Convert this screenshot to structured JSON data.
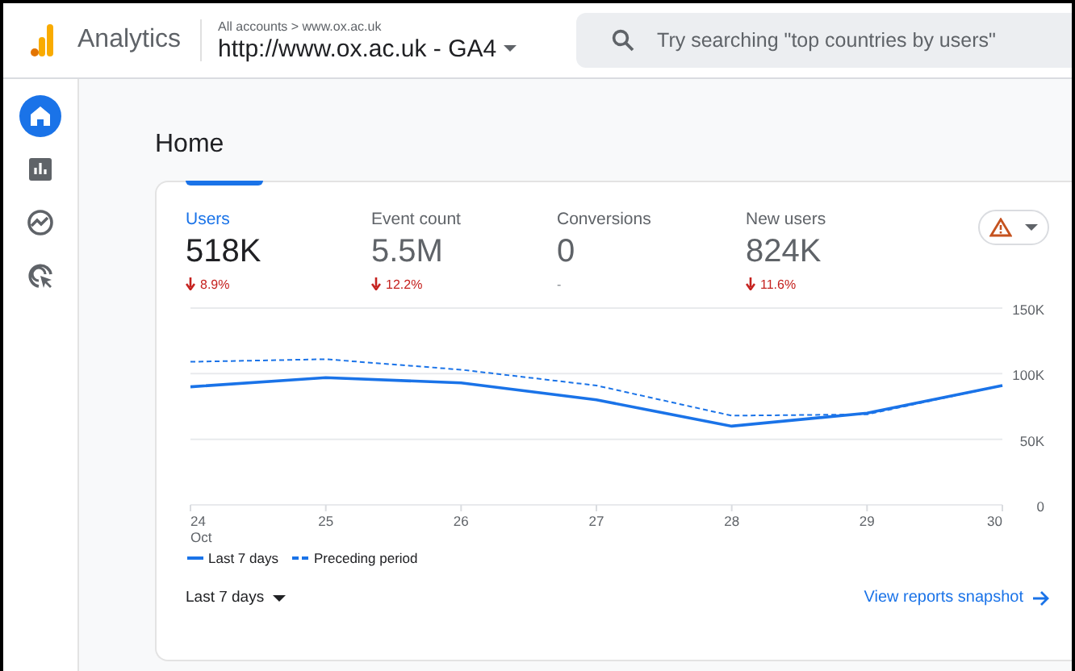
{
  "header": {
    "product": "Analytics",
    "breadcrumb": "All accounts > www.ox.ac.uk",
    "property": "http://www.ox.ac.uk - GA4",
    "search": {
      "placeholder": "Try searching \"top countries by users\""
    }
  },
  "sidebar": {
    "items": [
      {
        "kind": "home",
        "selected": true
      },
      {
        "kind": "reports",
        "selected": false
      },
      {
        "kind": "explore",
        "selected": false
      },
      {
        "kind": "advertising",
        "selected": false
      }
    ]
  },
  "page": {
    "title": "Home"
  },
  "metrics": [
    {
      "label": "Users",
      "value": "518K",
      "change": "8.9%",
      "kind": "down",
      "selected": true
    },
    {
      "label": "Event count",
      "value": "5.5M",
      "change": "12.2%",
      "kind": "down",
      "selected": false
    },
    {
      "label": "Conversions",
      "value": "0",
      "change": "-",
      "kind": "flat",
      "selected": false
    },
    {
      "label": "New users",
      "value": "824K",
      "change": "11.6%",
      "kind": "down",
      "selected": false
    }
  ],
  "alert_button": {
    "kind": "warning"
  },
  "chart_data": {
    "type": "line",
    "categories": [
      "24 Oct",
      "25",
      "26",
      "27",
      "28",
      "29",
      "30"
    ],
    "ylim": [
      0,
      150000
    ],
    "yticks": [
      {
        "value": 0,
        "label": "0"
      },
      {
        "value": 50000,
        "label": "50K"
      },
      {
        "value": 100000,
        "label": "100K"
      },
      {
        "value": 150000,
        "label": "150K"
      }
    ],
    "series": [
      {
        "name": "Last 7 days",
        "color": "#1a73e8",
        "line_style": "solid",
        "values": [
          90000,
          97000,
          93000,
          80000,
          60000,
          70000,
          91000
        ]
      },
      {
        "name": "Preceding period",
        "color": "#1a73e8",
        "line_style": "dashed",
        "values": [
          109000,
          111000,
          103000,
          91000,
          68000,
          69000,
          91000
        ]
      }
    ]
  },
  "footer": {
    "range": "Last 7 days",
    "link": "View reports snapshot"
  }
}
